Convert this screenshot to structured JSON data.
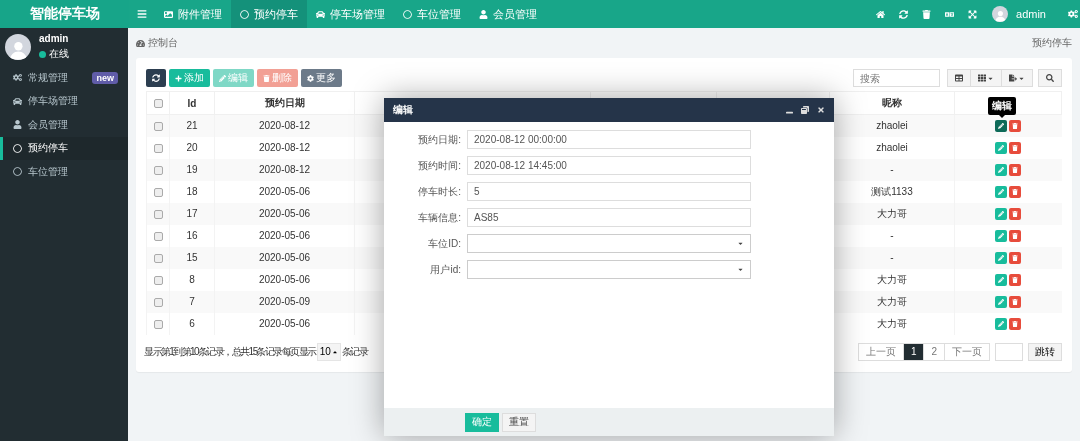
{
  "brand": "智能停车场",
  "nav": {
    "tabs": [
      {
        "label": "附件管理",
        "selected": false
      },
      {
        "label": "预约停车",
        "selected": true
      },
      {
        "label": "停车场管理",
        "selected": false
      },
      {
        "label": "车位管理",
        "selected": false
      },
      {
        "label": "会员管理",
        "selected": false
      }
    ],
    "user": "admin"
  },
  "sidebar": {
    "user": {
      "name": "admin",
      "status": "在线"
    },
    "items": [
      {
        "label": "常规管理",
        "badge": "new",
        "selected": false
      },
      {
        "label": "停车场管理",
        "selected": false
      },
      {
        "label": "会员管理",
        "selected": false
      },
      {
        "label": "预约停车",
        "selected": true
      },
      {
        "label": "车位管理",
        "selected": false
      }
    ]
  },
  "breadcrumb": {
    "home": "控制台",
    "current": "预约停车"
  },
  "toolbar": {
    "buttons": [
      {
        "label": "添加",
        "kind": "success",
        "disabled": false
      },
      {
        "label": "编辑",
        "kind": "success",
        "disabled": true
      },
      {
        "label": "删除",
        "kind": "danger",
        "disabled": true
      },
      {
        "label": "更多",
        "kind": "default",
        "disabled": false
      }
    ],
    "search": {
      "placeholder": "搜索"
    }
  },
  "table": {
    "columns": [
      "Id",
      "预约日期",
      "昵称"
    ],
    "tooltip": "编辑",
    "header_checked": false,
    "rows": [
      {
        "id": "21",
        "date": "2020-08-12",
        "nickname": "zhaolei",
        "checked": false,
        "hovered": true
      },
      {
        "id": "20",
        "date": "2020-08-12",
        "nickname": "zhaolei",
        "checked": false,
        "hovered": false
      },
      {
        "id": "19",
        "date": "2020-08-12",
        "nickname": "-",
        "checked": false,
        "hovered": false
      },
      {
        "id": "18",
        "date": "2020-05-06",
        "nickname": "测试1133",
        "checked": false,
        "hovered": false
      },
      {
        "id": "17",
        "date": "2020-05-06",
        "nickname": "大力哥",
        "checked": false,
        "hovered": false
      },
      {
        "id": "16",
        "date": "2020-05-06",
        "nickname": "-",
        "checked": false,
        "hovered": false
      },
      {
        "id": "15",
        "date": "2020-05-06",
        "nickname": "-",
        "checked": false,
        "hovered": false
      },
      {
        "id": "8",
        "date": "2020-05-06",
        "nickname": "大力哥",
        "checked": false,
        "hovered": false
      },
      {
        "id": "7",
        "date": "2020-05-09",
        "nickname": "大力哥",
        "checked": false,
        "hovered": false
      },
      {
        "id": "6",
        "date": "2020-05-06",
        "nickname": "大力哥",
        "checked": false,
        "hovered": false
      }
    ]
  },
  "pagination": {
    "summary": "显示第 1 到第 10 条记录，总共 15 条记录 每页显示",
    "page_size": "10",
    "suffix": "条记录",
    "prev": "上一页",
    "pages": [
      {
        "label": "1",
        "selected": true
      },
      {
        "label": "2",
        "selected": false
      }
    ],
    "next": "下一页",
    "jump": "跳转"
  },
  "modal": {
    "title": "编辑",
    "fields": [
      {
        "label": "预约日期:",
        "value": "2020-08-12 00:00:00",
        "kind": "text"
      },
      {
        "label": "预约时间:",
        "value": "2020-08-12 14:45:00",
        "kind": "text"
      },
      {
        "label": "停车时长:",
        "value": "5",
        "kind": "text"
      },
      {
        "label": "车辆信息:",
        "value": "AS85",
        "kind": "text"
      },
      {
        "label": "车位ID:",
        "kind": "select"
      },
      {
        "label": "用户id:",
        "kind": "select"
      }
    ],
    "buttons": [
      {
        "label": "确定",
        "kind": "primary"
      },
      {
        "label": "重置",
        "kind": "default"
      }
    ]
  }
}
